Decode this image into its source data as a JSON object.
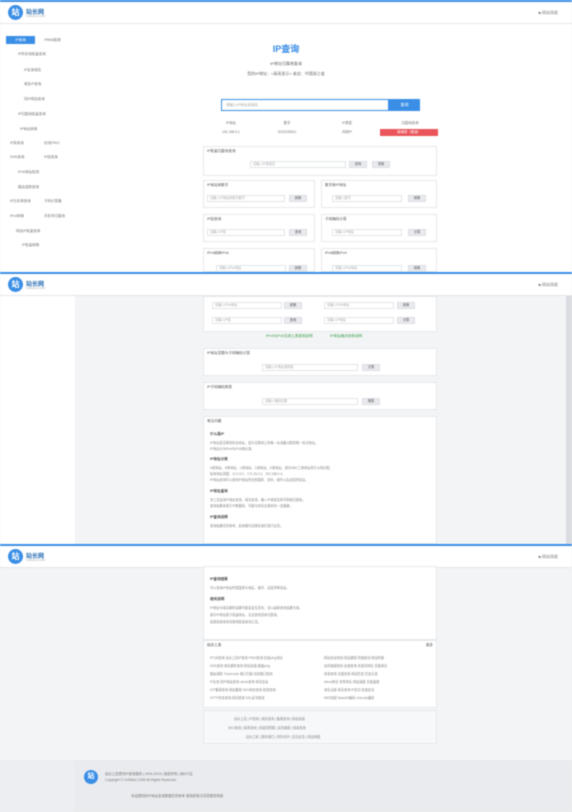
{
  "header": {
    "logo_glyph": "站",
    "logo_text": "站长网",
    "logo_sub": "CHINAZ.COM",
    "top_right": "■ 网站导航"
  },
  "sidebar": {
    "cat_active": "IP查询",
    "cat_other": "PING检测",
    "items": [
      "IP所在地批量查询",
      "IP反查域名",
      "域名IP查询",
      "同IP网站查询",
      "IP归属地批量查询",
      "IP地址转换",
      "IP库查询",
      "在线PING",
      "DNS查询",
      "IP段查询",
      "IPv6地址检测",
      "路由追踪查询",
      "IP白名单查询",
      "子网计算器",
      "IPv4转换",
      "手机号归属地",
      "网站IP批量查询",
      "IP批量转换"
    ]
  },
  "main": {
    "title": "IP查询",
    "subtitle": "IP地址归属地查询",
    "desc": "您的IP地址：<高亮显示> 来自：中国浙江省",
    "search_placeholder": "请输入IP地址或域名",
    "search_button": "查询",
    "result_grid": {
      "headers": [
        "IP地址",
        "数字",
        "IP类型",
        "归属地查询"
      ],
      "values": [
        "192.168.0.1",
        "3232235521",
        "内网IP",
        "局域网（错误）"
      ]
    },
    "panels": [
      {
        "title": "IP批量归属地查询",
        "placeholder": "请输入IP或域名",
        "buttons": [
          "查询",
          "重置"
        ]
      },
      {
        "title": "IP地址转数字",
        "placeholder": "请输入IP地址转换为数字",
        "buttons": [
          "转换"
        ]
      },
      {
        "title": "数字转IP地址",
        "placeholder": "请输入数字",
        "buttons": [
          "转换"
        ]
      },
      {
        "title": "IP段查询",
        "placeholder": "请输入IP段",
        "buttons": [
          "查询"
        ]
      },
      {
        "title": "子网掩码计算",
        "placeholder": "请输入IP地址",
        "buttons": [
          "计算"
        ]
      },
      {
        "title": "IPv4转换IPv6",
        "placeholder": "请输入IPv4地址",
        "buttons": [
          "转换"
        ]
      },
      {
        "title": "IPv6转换IPv4",
        "placeholder": "请输入IPv6地址",
        "buttons": [
          "转换"
        ]
      }
    ],
    "green_links": [
      "IPv4与IPv6互转工具使用说明",
      "IP地址格式转换说明"
    ],
    "panel_range": {
      "title": "IP地址范围与子网掩码计算",
      "placeholder": "请输入IP地址或网段",
      "button": "计算"
    },
    "panel_mask": {
      "title": "IP子网掩码换算",
      "placeholder": "请输入掩码位数",
      "button": "换算"
    },
    "faq": {
      "title": "常见问题",
      "sections": [
        {
          "head": "什么是IP",
          "lines": [
            "IP地址是互联网协议地址，是为互联网上的每一台设备分配的唯一标识地址。",
            "IP地址分为IPv4与IPv6两大类。"
          ]
        },
        {
          "head": "IP地址分类",
          "lines": [
            "A类地址、B类地址、C类地址、D类地址、E类地址，其中ABC三类地址用于公网分配。",
            "私有地址范围：10.0.0.0、172.16.0.0、192.168.0.0。",
            "IP地址查询可以查到IP地址所在的国家、省份、城市以及运营商信息。"
          ]
        },
        {
          "head": "IP地址查询",
          "lines": [
            "本工具支持IP地址查询、域名查询，输入IP或域名即可获取归属地。",
            "查询结果来源于IP数据库，可能与实际位置存在一定偏差。"
          ]
        },
        {
          "head": "IP查询说明",
          "lines": [
            "查询结果仅供参考，如有疑问请联系我们进行反馈。"
          ]
        }
      ]
    },
    "lower_sections": [
      {
        "head": "IP查询结果",
        "lines": [
          "可以查询IP地址所属国家与地区、城市、运营商等信息。"
        ]
      },
      {
        "head": "相关说明",
        "lines": [
          "IP地址与域名解析结果可能会发生变化，请以最新查询结果为准。",
          "部分IP地址属于保留地址，无法查询具体归属地。",
          "如需批量查询请使用批量查询工具。"
        ]
      }
    ],
    "links": {
      "title": "相关工具",
      "more": "更多",
      "left": [
        "IP138查询 站长工具IP查询 PING检测 在线ping测试",
        "DNS查询 域名解析查询 网站测速 超级ping",
        "路由追踪 Traceroute 端口扫描 在线端口检测",
        "IP反查 同IP网站查询 whois查询 域名信息",
        "ICP备案查询 网站备案 SEO综合查询 权重查询",
        "HTTP状态查询 网页检测 SSL证书检测"
      ],
      "right": [
        "网站安全检测 网站漏洞 死链检测 网站死链",
        "友情链接检测 友链查询 关键词排名 百度排名",
        "收录查询 百度收录 网站历史 历史记录",
        "Alexa排名 世界排名 网站速度 页面速度",
        "域名注册 域名查询 IP定位 精准定位",
        "MD5加密 Base64编码 Unicode编码"
      ]
    },
    "bottom_links": [
      "站长工具 | IP查询 | 域名查询 | 备案查询 | 网站测速",
      "SEO查询 | 权重查询 | 关键词挖掘 | 友情链接 | 收录查询",
      "站长之家 | 联系我们 | 商务合作 | 意见反馈 | 网站地图"
    ]
  },
  "footer": {
    "logo_glyph": "站",
    "line1": "站长工具提供IP查询服务 | 2004-2024 | 版权所有 | 闽ICP证",
    "line2": "Copyright © CHINAZ.COM All Rights Reserved",
    "line3": "本站提供的IP地址查询数据仅供参考 使用即表示同意服务条款"
  }
}
